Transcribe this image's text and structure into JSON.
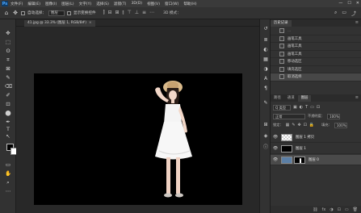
{
  "menu": {
    "logo": "Ps",
    "items": [
      "文件(F)",
      "编辑(E)",
      "图像(I)",
      "图层(L)",
      "文字(Y)",
      "选择(S)",
      "滤镜(T)",
      "3D(D)",
      "视图(V)",
      "窗口(W)",
      "帮助(H)"
    ],
    "window_controls": [
      "—",
      "☐",
      "✕"
    ]
  },
  "options": {
    "move_icon": "✥",
    "auto_select_label": "自动选择：",
    "auto_select_value": "图层",
    "transform_label": "显示变换控件",
    "align_icons": [
      "⫿",
      "⊟",
      "⊞",
      "⫾",
      "⊤",
      "⊥",
      "≡",
      "⋯"
    ],
    "mode3d_label": "3D 模式：",
    "right_icons": [
      "⌕",
      "▭",
      "⤴"
    ]
  },
  "document": {
    "tab_title": "41.jpg @ 33.3% (图层 1, RGB/8#)",
    "close_glyph": "×"
  },
  "tools": {
    "icons": [
      "✥",
      "⬚",
      "ʘ",
      "⌗",
      "⊠",
      "✎",
      "⌫",
      "✐",
      "⊡",
      "⬤",
      "✒",
      "T",
      "↖",
      "▭",
      "✋",
      "⌕",
      "⋯"
    ]
  },
  "history": {
    "tab_label": "历史记录",
    "items": [
      "画笔工具",
      "画笔工具",
      "画笔工具",
      "移动选区",
      "填充选区",
      "取消选择"
    ],
    "partial_top": "...",
    "active_index": 5
  },
  "layers": {
    "tabs": [
      "路径",
      "通道",
      "图层"
    ],
    "active_tab": 2,
    "kind_label": "Q 类型",
    "blend_mode": "正常",
    "opacity_label": "不透明度：",
    "opacity_value": "100%",
    "lock_label": "锁定：",
    "fill_label": "填充：",
    "fill_value": "100%",
    "rows": [
      {
        "name": "图层 1 拷贝",
        "thumb": "checker",
        "selected": false,
        "visible": true
      },
      {
        "name": "图层 1",
        "thumb": "black",
        "selected": false,
        "visible": true
      },
      {
        "name": "图层 0",
        "thumb": "photo",
        "selected": true,
        "visible": true
      }
    ],
    "bottom_icons": [
      "⛓",
      "fx",
      "◑",
      "⊡",
      "▭",
      "🗑"
    ]
  }
}
